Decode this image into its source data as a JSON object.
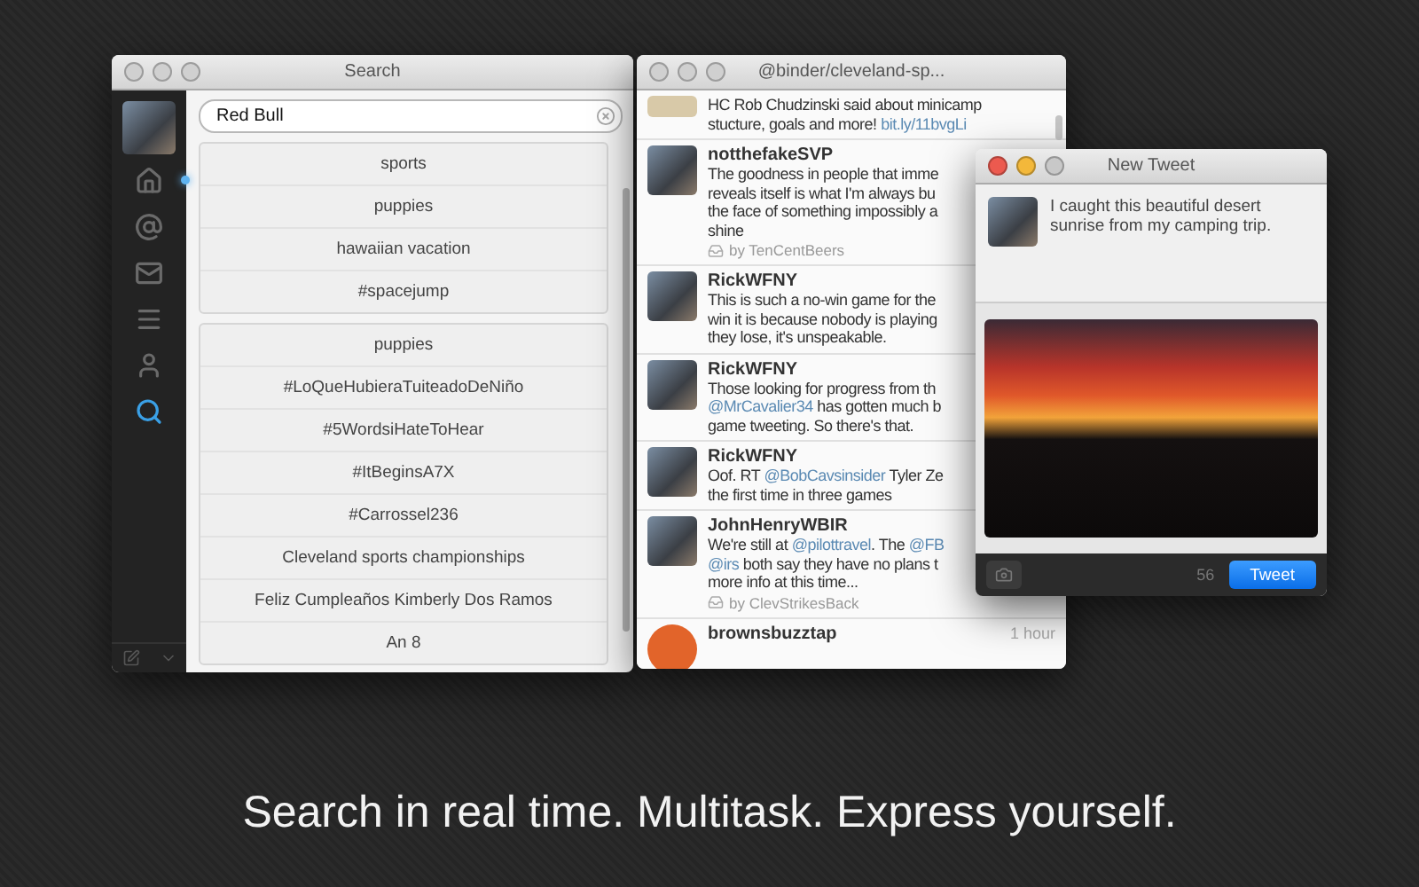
{
  "search_window": {
    "title": "Search",
    "sidebar": [
      {
        "kind": "home",
        "selected": false,
        "unread": true
      },
      {
        "kind": "mentions",
        "selected": false
      },
      {
        "kind": "messages",
        "selected": false
      },
      {
        "kind": "lists",
        "selected": false
      },
      {
        "kind": "profile",
        "selected": false
      },
      {
        "kind": "search",
        "selected": true
      }
    ],
    "search": {
      "value": "Red Bull"
    },
    "groups": [
      {
        "items": [
          "sports",
          "puppies",
          "hawaiian vacation",
          "#spacejump"
        ]
      },
      {
        "items": [
          "puppies",
          "#LoQueHubieraTuiteadoDeNiño",
          "#5WordsiHateToHear",
          "#ItBeginsA7X",
          "#Carrossel236",
          "Cleveland sports championships",
          "Feliz Cumpleaños Kimberly Dos Ramos",
          "An 8"
        ]
      }
    ]
  },
  "timeline_window": {
    "title": "@binder/cleveland-sp...",
    "tweets": [
      {
        "lines": [
          [
            {
              "t": "HC Rob Chudzinski said about minicamp"
            }
          ],
          [
            {
              "t": "stucture, goals and more! "
            },
            {
              "t": "bit.ly/11bvgLi",
              "link": true
            }
          ]
        ]
      },
      {
        "author": "notthefakeSVP",
        "lines": [
          [
            {
              "t": "The goodness in people that imme"
            }
          ],
          [
            {
              "t": "reveals itself is what I'm always bu"
            }
          ],
          [
            {
              "t": "the face of something impossibly a"
            }
          ],
          [
            {
              "t": "shine"
            }
          ]
        ],
        "via": "by TenCentBeers"
      },
      {
        "author": "RickWFNY",
        "lines": [
          [
            {
              "t": "This is such a no-win game for the"
            }
          ],
          [
            {
              "t": "win it is because nobody is playing"
            }
          ],
          [
            {
              "t": "they lose, it's unspeakable."
            }
          ]
        ]
      },
      {
        "author": "RickWFNY",
        "lines": [
          [
            {
              "t": "Those looking for progress from th"
            }
          ],
          [
            {
              "t": "@MrCavalier34",
              "link": true
            },
            {
              "t": " has gotten much b"
            }
          ],
          [
            {
              "t": "game tweeting. So there's that."
            }
          ]
        ]
      },
      {
        "author": "RickWFNY",
        "lines": [
          [
            {
              "t": "Oof. RT "
            },
            {
              "t": "@BobCavsinsider",
              "link": true
            },
            {
              "t": " Tyler Ze"
            }
          ],
          [
            {
              "t": "the first time in three games"
            }
          ]
        ]
      },
      {
        "author": "JohnHenryWBIR",
        "lines": [
          [
            {
              "t": "We're still at "
            },
            {
              "t": "@pilottravel",
              "link": true
            },
            {
              "t": ". The "
            },
            {
              "t": "@FB",
              "link": true
            }
          ],
          [
            {
              "t": "@irs",
              "link": true
            },
            {
              "t": " both say they have no plans t"
            }
          ],
          [
            {
              "t": "more info at this time..."
            }
          ]
        ],
        "via": "by ClevStrikesBack"
      },
      {
        "author": "brownsbuzztap",
        "time": "1 hour"
      }
    ]
  },
  "compose_window": {
    "title": "New Tweet",
    "text": "I caught this beautiful desert sunrise from my camping trip.",
    "count": "56",
    "button": "Tweet"
  },
  "caption": "Search in real time. Multitask. Express yourself."
}
